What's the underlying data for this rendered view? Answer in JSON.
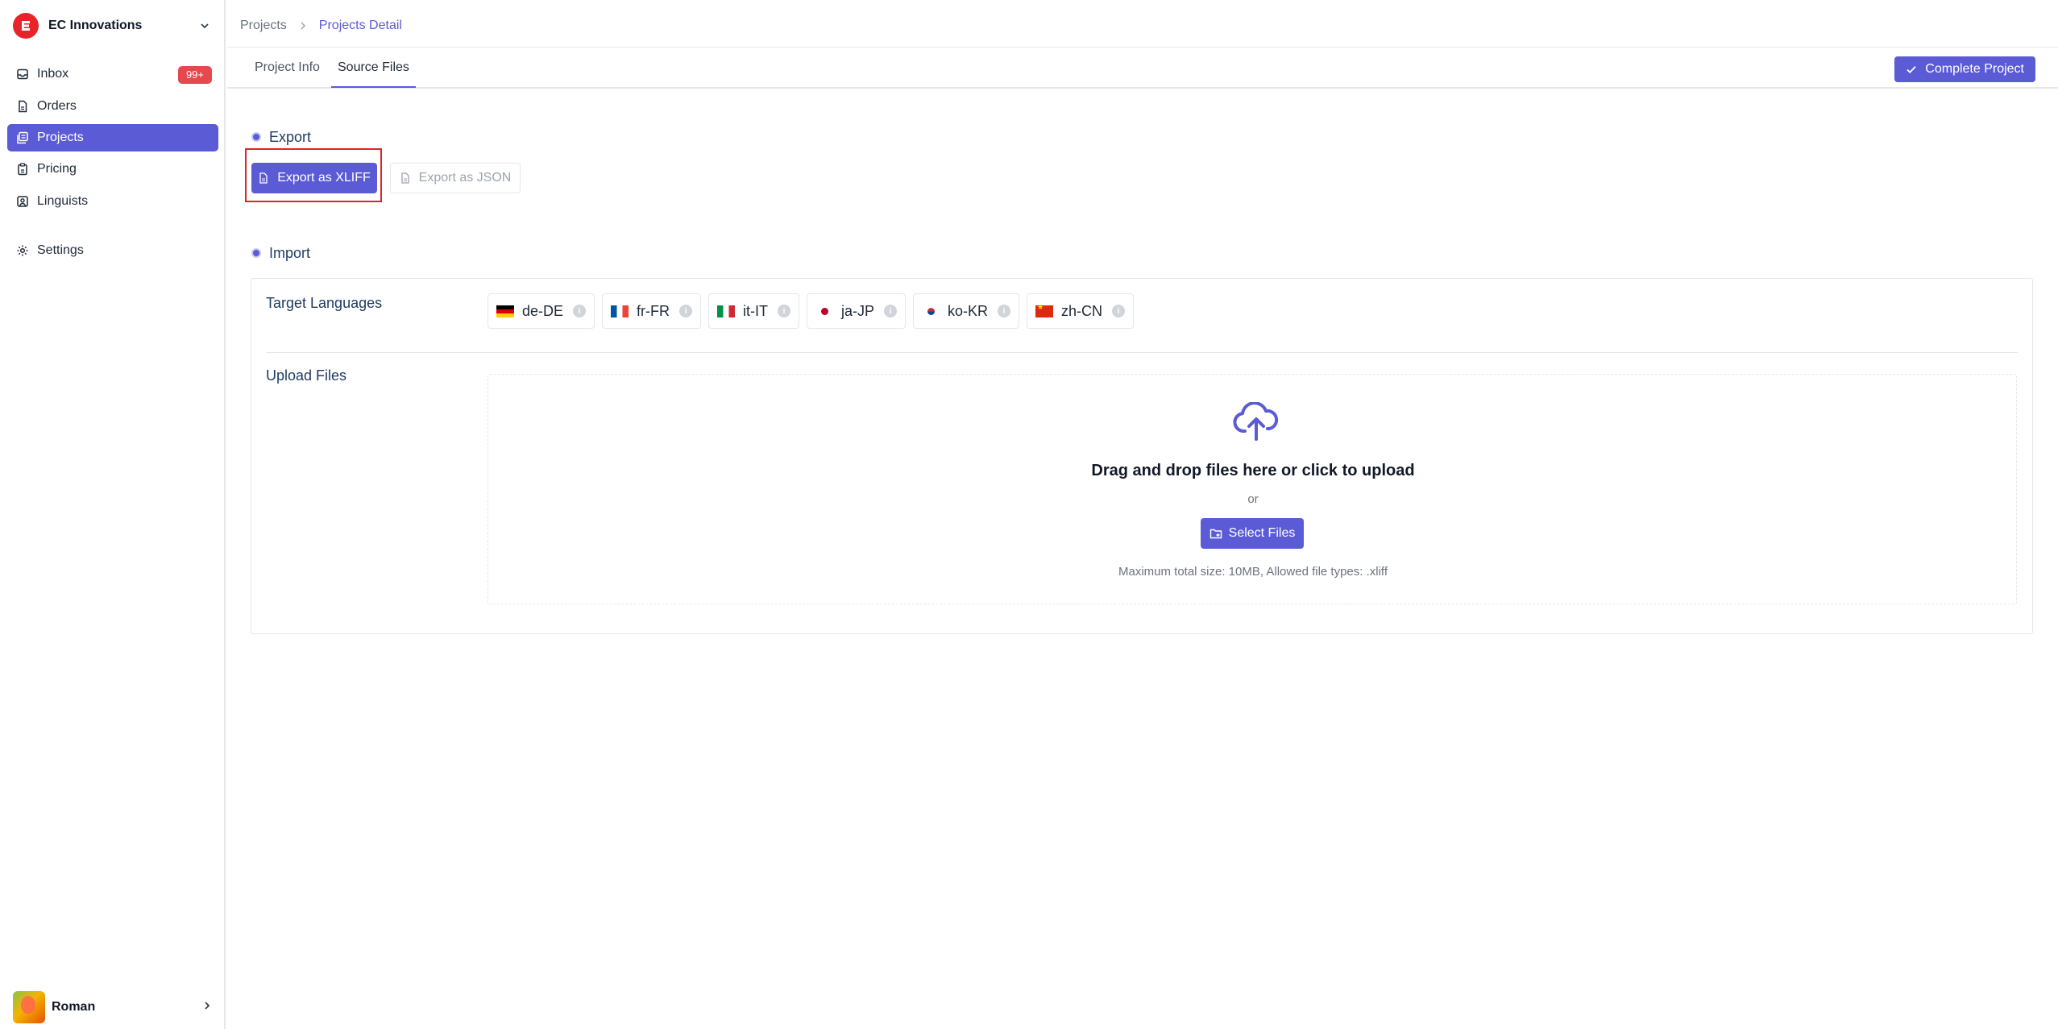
{
  "brand": {
    "name": "EC Innovations",
    "accent": "#5b5bd6",
    "logo_color": "#e5252a"
  },
  "sidebar": {
    "items": [
      {
        "label": "Inbox",
        "icon": "inbox-icon",
        "badge": "99+"
      },
      {
        "label": "Orders",
        "icon": "file-icon"
      },
      {
        "label": "Projects",
        "icon": "projects-icon",
        "active": true
      },
      {
        "label": "Pricing",
        "icon": "clipboard-icon"
      },
      {
        "label": "Linguists",
        "icon": "user-square-icon"
      },
      {
        "label": "Settings",
        "icon": "gear-icon"
      }
    ],
    "user": {
      "name": "Roman"
    }
  },
  "breadcrumb": {
    "items": [
      "Projects",
      "Projects Detail"
    ]
  },
  "tabs": [
    {
      "label": "Project Info"
    },
    {
      "label": "Source Files",
      "active": true
    }
  ],
  "header": {
    "complete_label": "Complete Project"
  },
  "export": {
    "title": "Export",
    "xliff_label": "Export as XLIFF",
    "json_label": "Export as JSON"
  },
  "import": {
    "title": "Import",
    "target_languages_label": "Target Languages",
    "languages": [
      "de-DE",
      "fr-FR",
      "it-IT",
      "ja-JP",
      "ko-KR",
      "zh-CN"
    ],
    "upload_label": "Upload Files",
    "dropzone": {
      "title": "Drag and drop files here or click to upload",
      "or": "or",
      "select_label": "Select Files",
      "hint": "Maximum total size: 10MB, Allowed file types: .xliff"
    }
  }
}
